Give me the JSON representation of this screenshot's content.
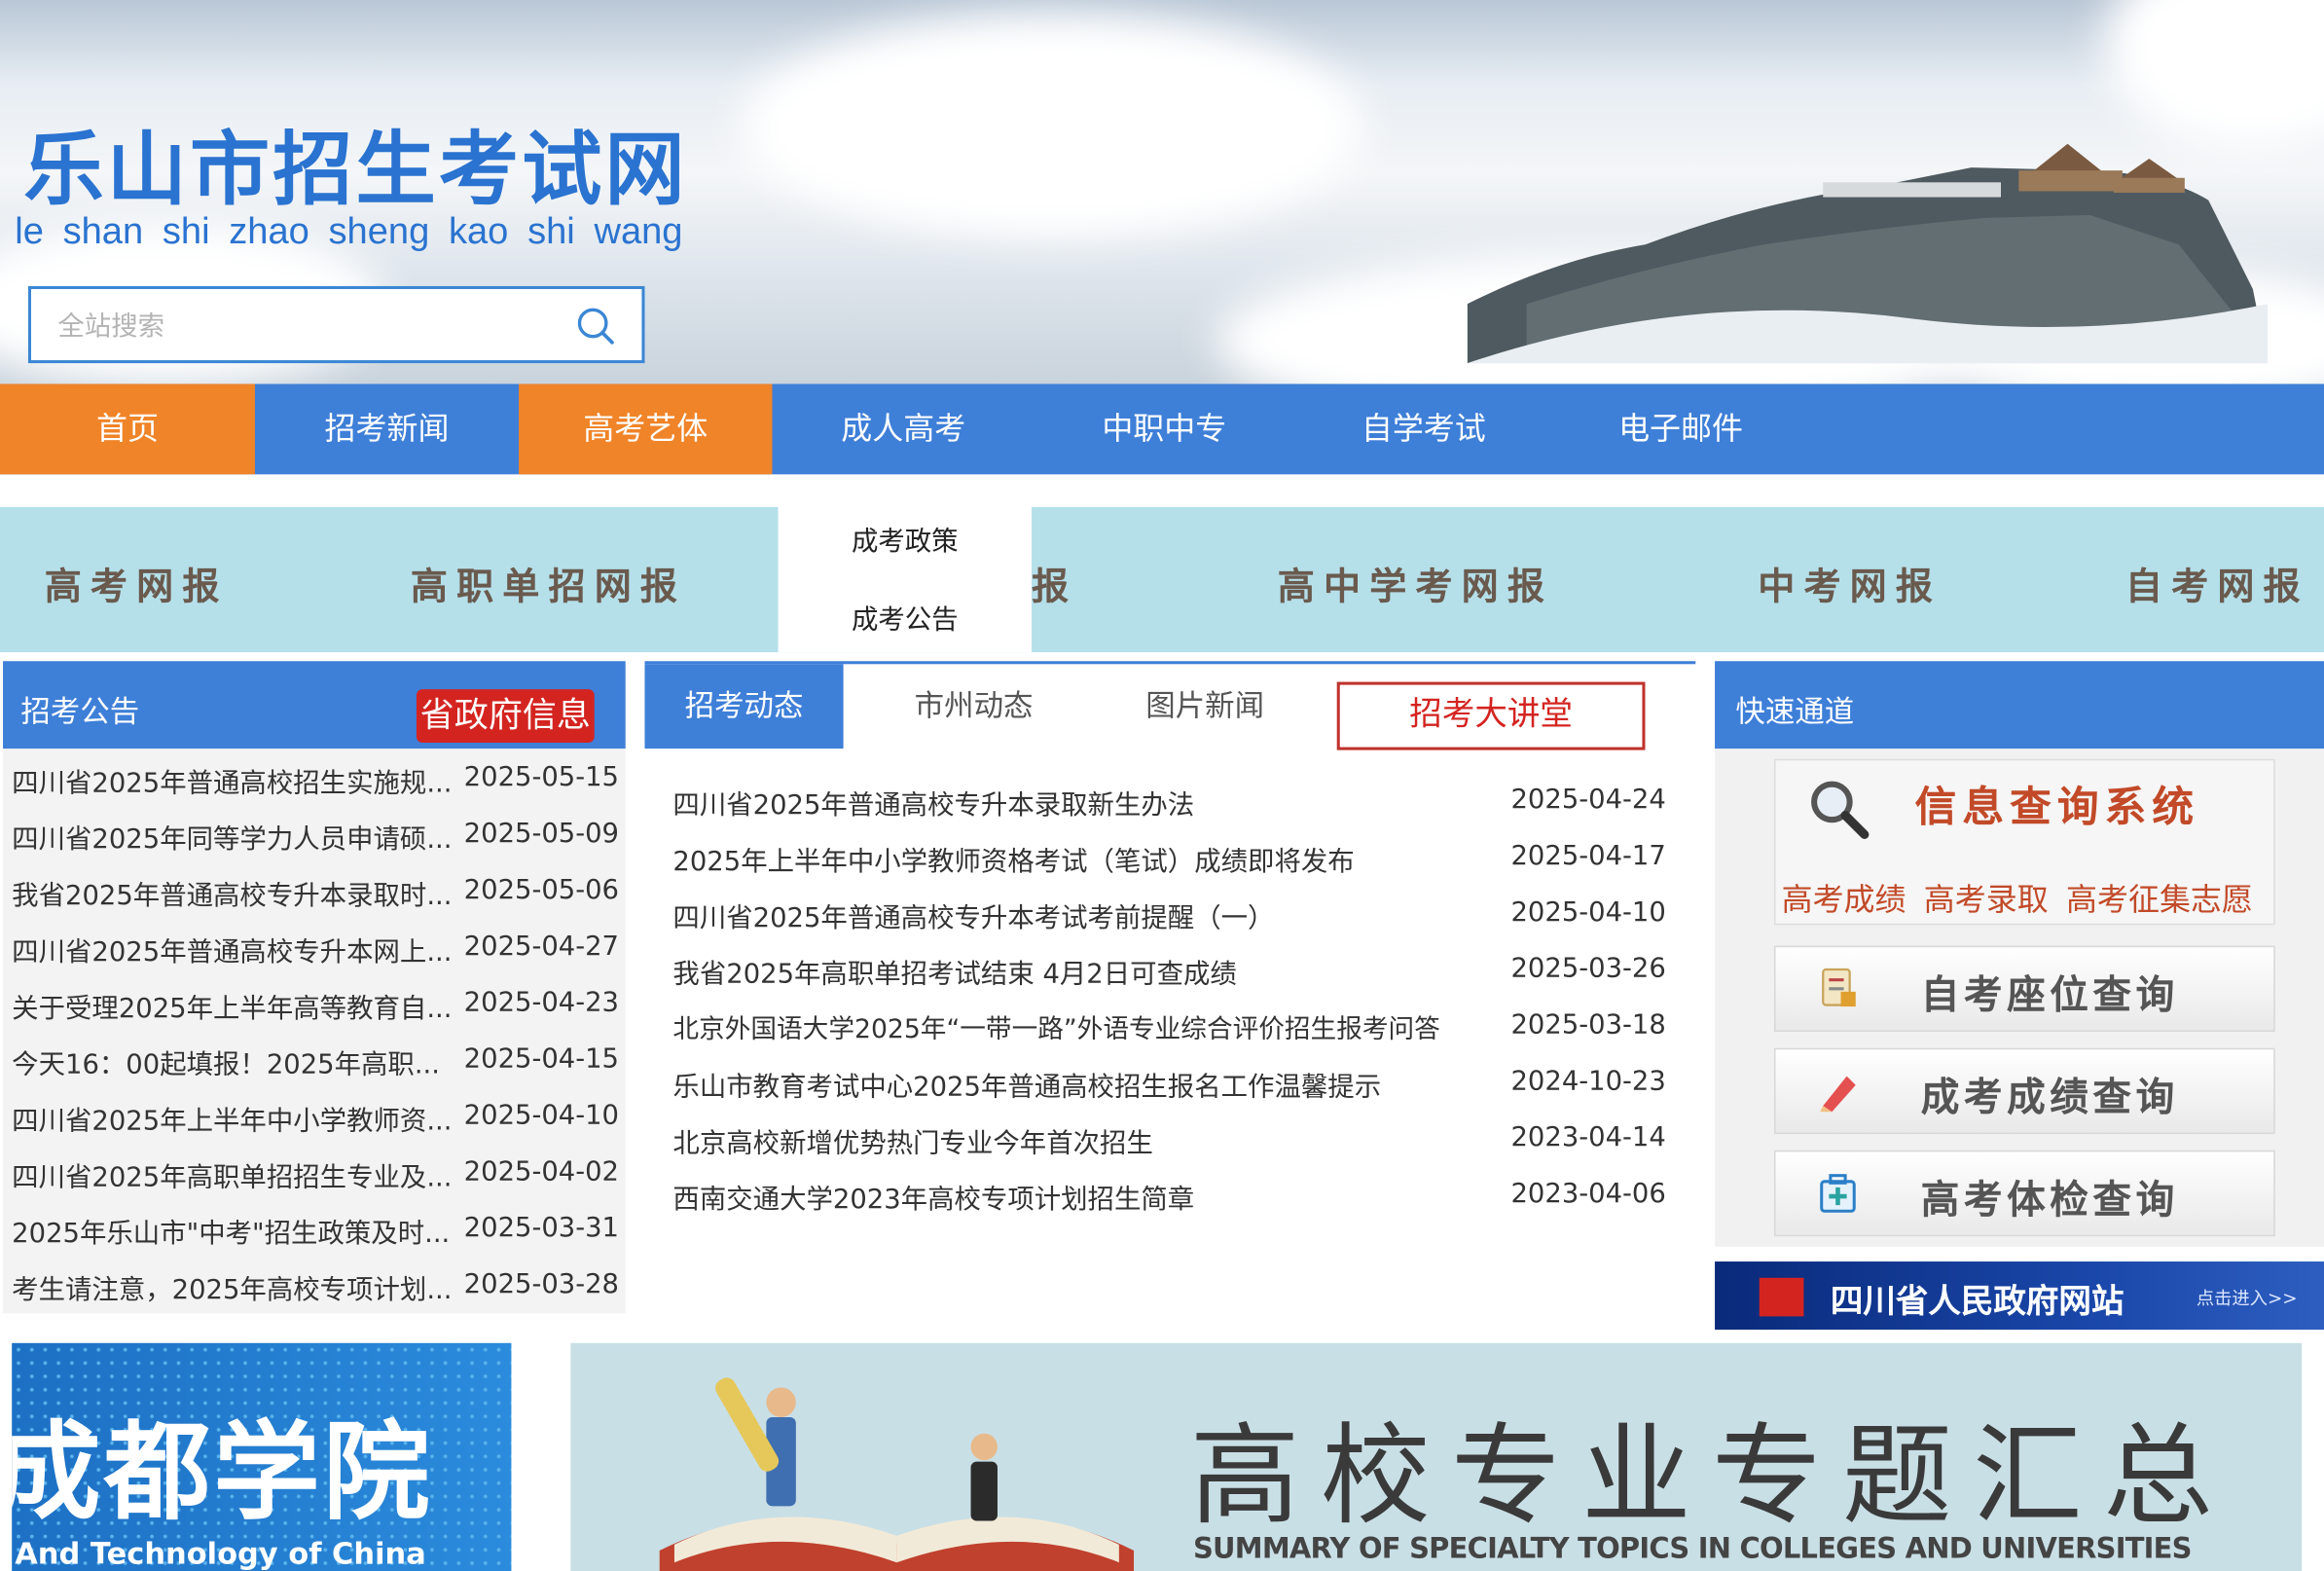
{
  "header": {
    "title": "乐山市招生考试网",
    "pinyin": "le  shan shi  zhao sheng kao shi wang",
    "search_placeholder": "全站搜索"
  },
  "nav": {
    "items": [
      {
        "label": "首页",
        "color": "#f08428"
      },
      {
        "label": "招考新闻",
        "color": "#3e7fd8"
      },
      {
        "label": "高考艺体",
        "color": "#f08428"
      },
      {
        "label": "成人高考",
        "color": "#3e7fd8"
      },
      {
        "label": "中职中专",
        "color": "#3e7fd8"
      },
      {
        "label": "自学考试",
        "color": "#3e7fd8"
      },
      {
        "label": "电子邮件",
        "color": "#3e7fd8"
      }
    ],
    "dropdown": [
      "成考政策",
      "成考公告"
    ]
  },
  "strip": {
    "items": [
      "高考网报",
      "高职单招网报",
      "报",
      "高中学考网报",
      "中考网报",
      "自考网报"
    ]
  },
  "left_panel": {
    "title": "招考公告",
    "gov_button": "省政府信息",
    "rows": [
      {
        "title": "四川省2025年普通高校招生实施规...",
        "date": "2025-05-15"
      },
      {
        "title": "四川省2025年同等学力人员申请硕...",
        "date": "2025-05-09"
      },
      {
        "title": "我省2025年普通高校专升本录取时...",
        "date": "2025-05-06"
      },
      {
        "title": "四川省2025年普通高校专升本网上...",
        "date": "2025-04-27"
      },
      {
        "title": "关于受理2025年上半年高等教育自...",
        "date": "2025-04-23"
      },
      {
        "title": "今天16：00起填报！2025年高职...",
        "date": "2025-04-15"
      },
      {
        "title": "四川省2025年上半年中小学教师资...",
        "date": "2025-04-10"
      },
      {
        "title": "四川省2025年高职单招招生专业及...",
        "date": "2025-04-02"
      },
      {
        "title": "2025年乐山市\"中考\"招生政策及时...",
        "date": "2025-03-31"
      },
      {
        "title": "考生请注意，2025年高校专项计划...",
        "date": "2025-03-28"
      }
    ]
  },
  "mid_panel": {
    "tabs": [
      "招考动态",
      "市州动态",
      "图片新闻"
    ],
    "lecture_button": "招考大讲堂",
    "rows": [
      {
        "title": "四川省2025年普通高校专升本录取新生办法",
        "date": "2025-04-24"
      },
      {
        "title": "2025年上半年中小学教师资格考试（笔试）成绩即将发布",
        "date": "2025-04-17"
      },
      {
        "title": "四川省2025年普通高校专升本考试考前提醒（一）",
        "date": "2025-04-10"
      },
      {
        "title": "我省2025年高职单招考试结束 4月2日可查成绩",
        "date": "2025-03-26"
      },
      {
        "title": "北京外国语大学2025年“一带一路”外语专业综合评价招生报考问答",
        "date": "2025-03-18"
      },
      {
        "title": "乐山市教育考试中心2025年普通高校招生报名工作温馨提示",
        "date": "2024-10-23"
      },
      {
        "title": "北京高校新增优势热门专业今年首次招生",
        "date": "2023-04-14"
      },
      {
        "title": "西南交通大学2023年高校专项计划招生简章",
        "date": "2023-04-06"
      }
    ]
  },
  "right_panel": {
    "title": "快速通道",
    "info_title": "信息查询系统",
    "info_links": [
      "高考成绩",
      "高考录取",
      "高考征集志愿"
    ],
    "buttons": [
      {
        "label": "自考座位查询",
        "icon": "seat-form-icon"
      },
      {
        "label": "成考成绩查询",
        "icon": "pencil-icon"
      },
      {
        "label": "高考体检查询",
        "icon": "medical-kit-icon"
      }
    ],
    "gov_banner": {
      "text": "四川省人民政府网站",
      "enter": "点击进入>>"
    }
  },
  "banners": {
    "left": {
      "title": "成都学院",
      "subtitle": "And Technology of China"
    },
    "right": {
      "title": "高校专业专题汇总",
      "subtitle": "SUMMARY OF SPECIALTY TOPICS IN COLLEGES AND UNIVERSITIES"
    }
  },
  "colors": {
    "primary_blue": "#3e7fd8",
    "orange": "#f08428",
    "red": "#d42420",
    "strip": "#b5e0ea"
  }
}
